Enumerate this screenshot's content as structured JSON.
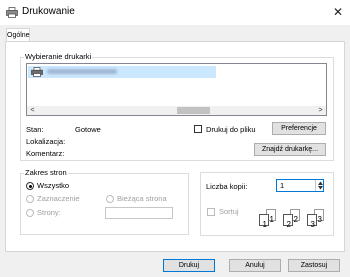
{
  "window": {
    "title": "Drukowanie",
    "close_glyph": "✕"
  },
  "tabs": [
    {
      "label": "Ogólne"
    }
  ],
  "select_printer": {
    "label": "Wybieranie drukarki",
    "scroll_left": "<",
    "scroll_right": ">",
    "status_label": "Stan:",
    "status_value": "Gotowe",
    "location_label": "Lokalizacja:",
    "comment_label": "Komentarz:",
    "print_to_file_label": "Drukuj do pliku",
    "preferences_button": "Preferencje",
    "find_printer_button": "Znajdź drukarkę..."
  },
  "page_range": {
    "label": "Zakres stron",
    "all": "Wszystko",
    "selection": "Zaznaczenie",
    "current_page": "Bieżąca strona",
    "pages": "Strony:",
    "pages_value": ""
  },
  "copies": {
    "label": "Liczba kopii:",
    "value": "1",
    "collate_label": "Sortuj",
    "page_numbers": [
      "1",
      "1",
      "2",
      "2",
      "3",
      "3"
    ]
  },
  "footer": {
    "print_button": "Drukuj",
    "cancel_button": "Anuluj",
    "apply_button": "Zastosuj"
  },
  "colors": {
    "accent": "#0078d7",
    "selection": "#cce8ff"
  },
  "icons": {
    "app": "printer-icon",
    "close": "close-icon",
    "list_item": "printer-icon"
  }
}
